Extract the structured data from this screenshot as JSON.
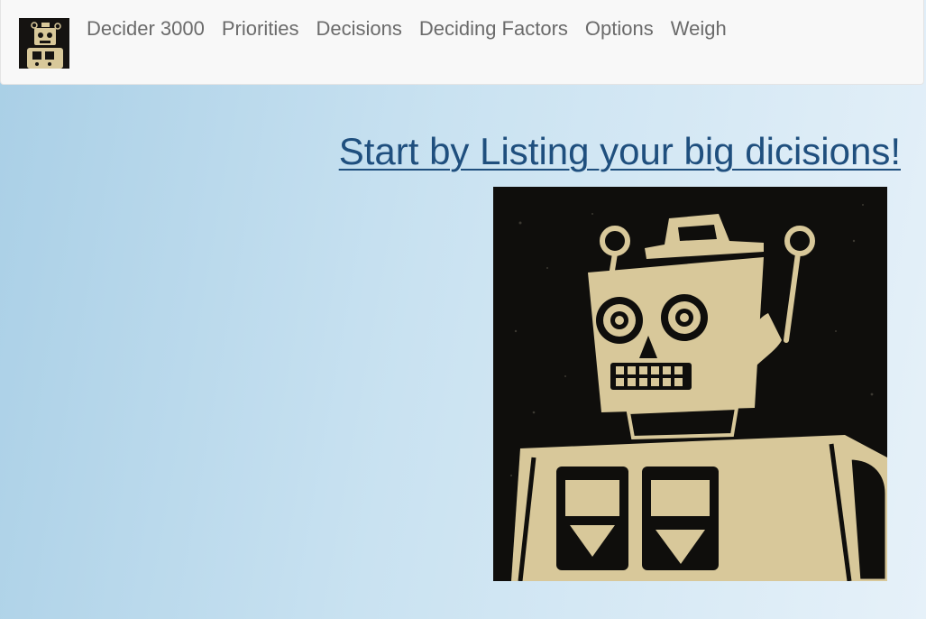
{
  "navbar": {
    "brand_icon": "robot-icon",
    "items": [
      {
        "label": "Decider 3000"
      },
      {
        "label": "Priorities"
      },
      {
        "label": "Decisions"
      },
      {
        "label": "Deciding Factors"
      },
      {
        "label": "Options"
      },
      {
        "label": "Weigh"
      }
    ]
  },
  "main": {
    "headline": "Start by Listing your big dicisions!",
    "hero_image": "robot-linocut-illustration"
  },
  "colors": {
    "background_start": "#a9cfe6",
    "background_end": "#e6f1f9",
    "navbar_bg": "#f8f8f8",
    "nav_text": "#6b6b6b",
    "link": "#1f4f7e",
    "robot_fill": "#d8c89a",
    "robot_bg": "#0f0e0c"
  }
}
